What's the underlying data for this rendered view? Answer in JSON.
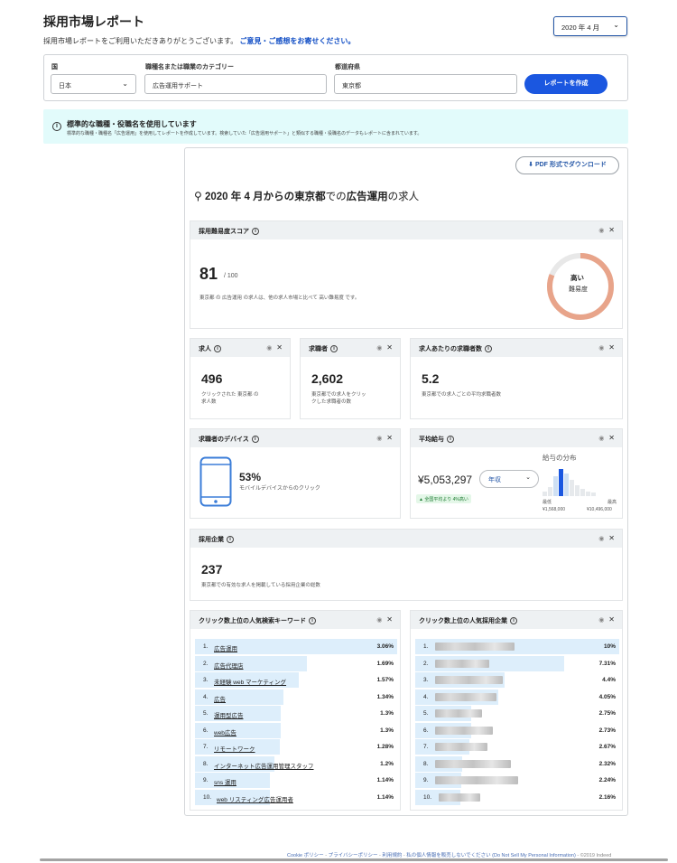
{
  "header": {
    "title": "採用市場レポート",
    "subtitle": "採用市場レポートをご利用いただきありがとうございます。",
    "feedback_link": "ご意見・ご感想をお寄せください。",
    "month": "2020 年 4 月"
  },
  "form": {
    "country_label": "国",
    "country_value": "日本",
    "job_label": "職種名または職業のカテゴリー",
    "job_value": "広告運用サポート",
    "pref_label": "都道府県",
    "pref_value": "東京都",
    "submit_label": "レポートを作成"
  },
  "notice": {
    "title": "標準的な職種・役職名を使用しています",
    "body": "標準的な職種・職種名「広告運用」を使用してレポートを作成しています。検索していた「広告運用サポート」と類似する職種・役職名のデータもレポートに含まれています。"
  },
  "report": {
    "pdf_label": "PDF 形式でダウンロード",
    "heading_pre": "2020 年 4 月からの",
    "heading_loc": "東京都",
    "heading_mid": "での",
    "heading_job": "広告運用",
    "heading_post": "の求人",
    "difficulty": {
      "title": "採用難易度スコア",
      "score": "81",
      "out_of": "/ 100",
      "desc": "東京都 の 広告運用 の求人は、他の求人市場と比べて 高い難易度 です。",
      "level": "高い",
      "level_label": "難易度",
      "value": 81,
      "max": 100
    },
    "jobs": {
      "title": "求人",
      "value": "496",
      "desc": "クリックされた 東京都 の求人数"
    },
    "seekers": {
      "title": "求職者",
      "value": "2,602",
      "desc": "東京都での求人をクリックした求職者の数"
    },
    "per_job": {
      "title": "求人あたりの求職者数",
      "value": "5.2",
      "desc": "東京都での求人ごとの平均求職者数"
    },
    "device": {
      "title": "求職者のデバイス",
      "value": "53%",
      "desc": "モバイルデバイスからのクリック"
    },
    "salary": {
      "title": "平均給与",
      "value": "¥5,053,297",
      "period": "年収",
      "badge": "▲ 全国平均より 4%高い",
      "dist_title": "給与の分布",
      "min_label": "最低",
      "max_label": "最高",
      "min_value": "¥1,568,000",
      "max_value": "¥10,496,000"
    },
    "companies": {
      "title": "採用企業",
      "value": "237",
      "desc": "東京都での有効な求人を掲載している採用企業の総数"
    },
    "keywords": {
      "title": "クリック数上位の人気検索キーワード",
      "items": [
        {
          "idx": "1.",
          "text": "広告運用",
          "value": "3.06%",
          "pct": 3.06
        },
        {
          "idx": "2.",
          "text": "広告代理店",
          "value": "1.69%",
          "pct": 1.69
        },
        {
          "idx": "3.",
          "text": "未経験 web マーケティング",
          "value": "1.57%",
          "pct": 1.57
        },
        {
          "idx": "4.",
          "text": "広告",
          "value": "1.34%",
          "pct": 1.34
        },
        {
          "idx": "5.",
          "text": "運用型広告",
          "value": "1.3%",
          "pct": 1.3
        },
        {
          "idx": "6.",
          "text": "web広告",
          "value": "1.3%",
          "pct": 1.3
        },
        {
          "idx": "7.",
          "text": "リモートワーク",
          "value": "1.28%",
          "pct": 1.28
        },
        {
          "idx": "8.",
          "text": "インターネット広告運用管理スタッフ",
          "value": "1.2%",
          "pct": 1.2
        },
        {
          "idx": "9.",
          "text": "sns 運用",
          "value": "1.14%",
          "pct": 1.14
        },
        {
          "idx": "10.",
          "text": "web リスティング広告運用者",
          "value": "1.14%",
          "pct": 1.14
        }
      ]
    },
    "top_companies": {
      "title": "クリック数上位の人気採用企業",
      "items": [
        {
          "idx": "1.",
          "value": "10%",
          "pct": 10
        },
        {
          "idx": "2.",
          "value": "7.31%",
          "pct": 7.31
        },
        {
          "idx": "3.",
          "value": "4.4%",
          "pct": 4.4
        },
        {
          "idx": "4.",
          "value": "4.05%",
          "pct": 4.05
        },
        {
          "idx": "5.",
          "value": "2.75%",
          "pct": 2.75
        },
        {
          "idx": "6.",
          "value": "2.73%",
          "pct": 2.73
        },
        {
          "idx": "7.",
          "value": "2.67%",
          "pct": 2.67
        },
        {
          "idx": "8.",
          "value": "2.32%",
          "pct": 2.32
        },
        {
          "idx": "9.",
          "value": "2.24%",
          "pct": 2.24
        },
        {
          "idx": "10.",
          "value": "2.16%",
          "pct": 2.16
        }
      ]
    }
  },
  "footer": {
    "cookie": "Cookie ポリシー",
    "privacy": "プライバシーポリシー",
    "terms": "利用規約",
    "donotsell": "私の個人情報を販売しないでください (Do Not Sell My Personal Information)",
    "copyright": "©2019 Indeed"
  },
  "colors": {
    "accent": "#1b57e0",
    "gauge": "#e8a48a",
    "notice_bg": "#e2fbfb",
    "bar": "#ddeefb"
  }
}
